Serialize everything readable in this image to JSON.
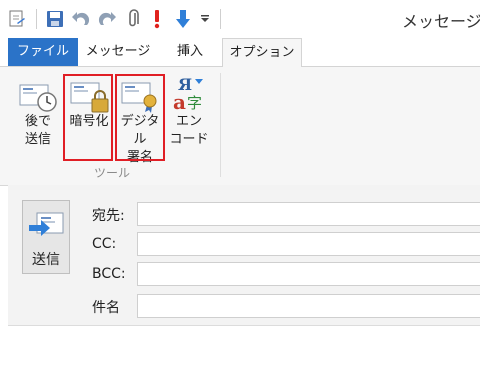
{
  "window": {
    "title": "メッセージの"
  },
  "tabs": [
    {
      "label": "ファイル"
    },
    {
      "label": "メッセージ"
    },
    {
      "label": "挿入"
    },
    {
      "label": "オプション"
    }
  ],
  "ribbon": {
    "buttons": [
      {
        "line1": "後で",
        "line2": "送信"
      },
      {
        "line1": "暗号化",
        "line2": ""
      },
      {
        "line1": "デジタル",
        "line2": "署名"
      },
      {
        "line1": "エン",
        "line2": "コード"
      }
    ],
    "group_label": "ツール"
  },
  "compose": {
    "send_label": "送信",
    "to_label": "宛先:",
    "cc_label": "CC:",
    "bcc_label": "BCC:",
    "subject_label": "件名",
    "to_value": "",
    "cc_value": "",
    "bcc_value": "",
    "subject_value": ""
  },
  "colors": {
    "file_tab": "#2b73c8",
    "highlight": "#e01e25",
    "ribbon_bg": "#f6f6f6"
  }
}
